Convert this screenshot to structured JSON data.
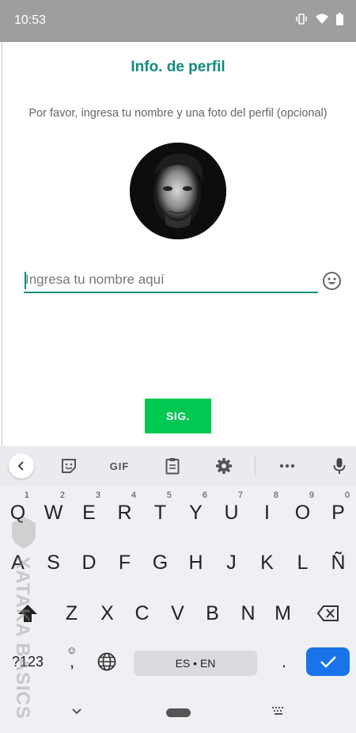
{
  "status_bar": {
    "time": "10:53",
    "icons": [
      "vibrate-icon",
      "wifi-icon",
      "battery-icon"
    ]
  },
  "profile": {
    "title": "Info. de perfil",
    "subtitle": "Por favor, ingresa tu nombre y una foto del perfil (opcional)",
    "name_placeholder": "Ingresa tu nombre aquí",
    "name_value": "",
    "next_label": "SIG."
  },
  "colors": {
    "accent": "#128c7e",
    "button": "#00c853",
    "enter_key": "#1a73e8",
    "status_bar": "#9e9e9e"
  },
  "keyboard": {
    "toolbar": {
      "gif_label": "GIF",
      "icons": [
        "back-icon",
        "sticker-icon",
        "gif-icon",
        "clipboard-icon",
        "settings-icon",
        "more-icon",
        "mic-icon"
      ]
    },
    "row1": [
      {
        "label": "Q",
        "num": "1"
      },
      {
        "label": "W",
        "num": "2"
      },
      {
        "label": "E",
        "num": "3"
      },
      {
        "label": "R",
        "num": "4"
      },
      {
        "label": "T",
        "num": "5"
      },
      {
        "label": "Y",
        "num": "6"
      },
      {
        "label": "U",
        "num": "7"
      },
      {
        "label": "I",
        "num": "8"
      },
      {
        "label": "O",
        "num": "9"
      },
      {
        "label": "P",
        "num": "0"
      }
    ],
    "row2": [
      "A",
      "S",
      "D",
      "F",
      "G",
      "H",
      "J",
      "K",
      "L",
      "Ñ"
    ],
    "row3": [
      "Z",
      "X",
      "C",
      "V",
      "B",
      "N",
      "M"
    ],
    "symbols_label": "?123",
    "comma_label": ",",
    "space_label": "ES • EN",
    "period_label": "."
  },
  "watermark": {
    "text": "XATAKA BASICS"
  }
}
